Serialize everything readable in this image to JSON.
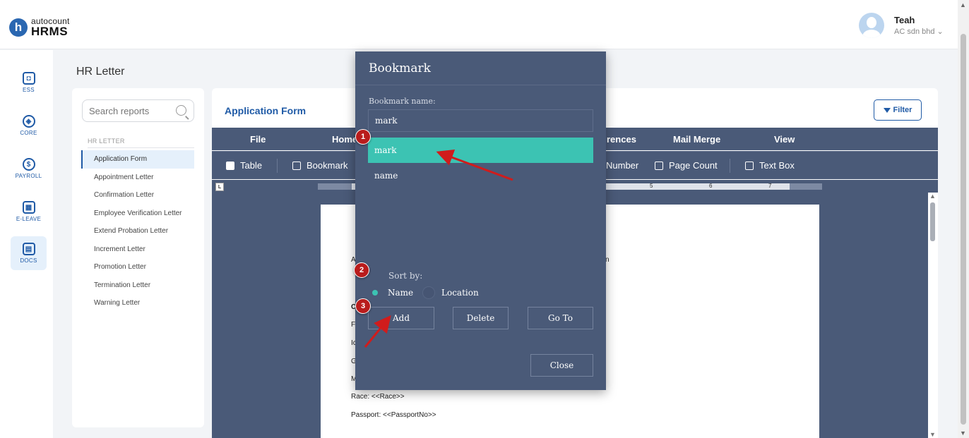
{
  "header": {
    "logo_letter": "h",
    "logo_top": "autocount",
    "logo_bottom": "HRMS",
    "user_name": "Teah",
    "user_company": "AC sdn bhd"
  },
  "leftnav": [
    {
      "label": "ESS",
      "icon": "id-card-icon"
    },
    {
      "label": "CORE",
      "icon": "cube-icon"
    },
    {
      "label": "PAYROLL",
      "icon": "dollar-icon"
    },
    {
      "label": "E-LEAVE",
      "icon": "calendar-icon"
    },
    {
      "label": "DOCS",
      "icon": "document-chart-icon",
      "active": true
    }
  ],
  "page_title": "HR Letter",
  "reports": {
    "search_placeholder": "Search reports",
    "group_label": "HR LETTER",
    "items": [
      "Application Form",
      "Appointment Letter",
      "Confirmation Letter",
      "Employee Verification Letter",
      "Extend Probation Letter",
      "Increment Letter",
      "Promotion Letter",
      "Termination Letter",
      "Warning Letter"
    ],
    "active_index": 0
  },
  "main": {
    "title": "Application Form",
    "filter_label": "Filter",
    "menu": [
      "File",
      "Home",
      "rences",
      "Mail Merge",
      "View"
    ],
    "tools": [
      "Table",
      "Bookmark",
      "Number",
      "Page Count",
      "Text Box"
    ],
    "ruler_marker": "L",
    "ruler_nums": [
      "5",
      "6",
      "7"
    ],
    "doc_lines": [
      "Race: <<Race>>",
      "Passport: <<PassportNo>>"
    ],
    "doc_partials": [
      "A",
      "n",
      "C",
      "F",
      "Ic",
      "G",
      "M"
    ]
  },
  "dialog": {
    "title": "Bookmark",
    "name_label": "Bookmark name:",
    "name_value": "mark",
    "bookmarks": [
      "mark",
      "name"
    ],
    "selected_index": 0,
    "sort_label": "Sort by:",
    "sort_options": [
      "Name",
      "Location"
    ],
    "sort_selected": "Name",
    "buttons": {
      "add": "Add",
      "delete": "Delete",
      "goto": "Go To",
      "close": "Close"
    }
  },
  "annotations": {
    "steps": [
      "1",
      "2",
      "3"
    ],
    "color": "#b91c1c"
  },
  "colors": {
    "brand_blue": "#1f5aa6",
    "toolbar": "#4a5a78",
    "selection_teal": "#3cc3b3"
  }
}
